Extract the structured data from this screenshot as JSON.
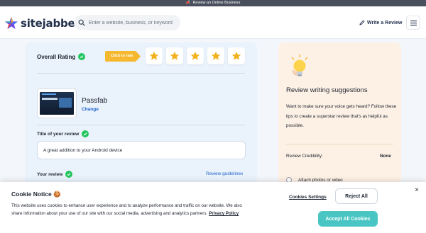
{
  "top_strip": {
    "text": "Review an Online Business",
    "icon": "megaphone-icon"
  },
  "header": {
    "logo_text": "sitejabber",
    "search_placeholder": "Enter a website, business, or keyword",
    "write_review_label": "Write a Review",
    "menu_icon": "hamburger-icon"
  },
  "form": {
    "overall_rating_label": "Overall Rating",
    "click_to_rate_label": "Click to rate",
    "stars_count": 5,
    "business_name": "Passfab",
    "change_label": "Change",
    "title_label": "Title of your review",
    "title_value": "A great addition to your Android device",
    "review_label": "Your review",
    "guidelines_label": "Review guidelines"
  },
  "suggestions": {
    "title": "Review writing suggestions",
    "body": "Want to make sure your voice gets heard? Follow these tips to create a superstar review that's as helpful as possible.",
    "credibility_label": "Review Credibility:",
    "credibility_value": "None",
    "attach_label": "Attach photos or video"
  },
  "cookie": {
    "title": "Cookie Notice 🍪",
    "text": "This website uses cookies to enhance user experience and to analyze performance and traffic on our website. We also share information about your use of our site with our social media, advertising and analytics partners.",
    "policy_link": "Privacy Policy",
    "settings_label": "Cookies Settings",
    "reject_label": "Reject All",
    "accept_label": "Accept All Cookies",
    "close_label": "×"
  },
  "colors": {
    "accent_blue": "#1d63c9",
    "check_green": "#22c55e",
    "rate_yellow": "#f5b82e",
    "star_gold": "#f2b21c",
    "accept_teal": "#49c6c3",
    "left_panel_bg": "#eaf2fc",
    "right_panel_bg": "#fdf1e5"
  }
}
